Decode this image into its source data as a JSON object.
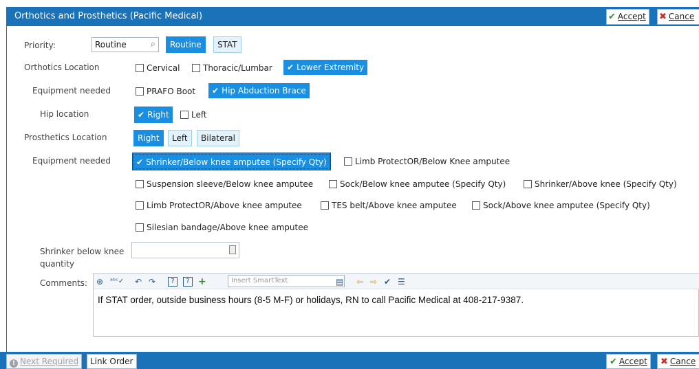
{
  "window": {
    "title": "Orthotics and Prosthetics (Pacific Medical)",
    "accept_label": "Accept",
    "cancel_label": "Cance"
  },
  "priority": {
    "label": "Priority:",
    "value": "Routine",
    "buttons": [
      "Routine",
      "STAT"
    ],
    "selected": "Routine"
  },
  "orthotics_location": {
    "label": "Orthotics Location",
    "options": [
      {
        "label": "Cervical",
        "checked": false
      },
      {
        "label": "Thoracic/Lumbar",
        "checked": false
      },
      {
        "label": "Lower Extremity",
        "checked": true
      }
    ]
  },
  "orthotics_equipment": {
    "label": "Equipment needed",
    "options": [
      {
        "label": "PRAFO Boot",
        "checked": false
      },
      {
        "label": "Hip Abduction Brace",
        "checked": true
      }
    ]
  },
  "hip_location": {
    "label": "Hip location",
    "options": [
      {
        "label": "Right",
        "checked": true
      },
      {
        "label": "Left",
        "checked": false
      }
    ]
  },
  "prosthetics_location": {
    "label": "Prosthetics Location",
    "buttons": [
      "Right",
      "Left",
      "Bilateral"
    ],
    "selected": "Right"
  },
  "prosthetics_equipment": {
    "label": "Equipment needed",
    "options": [
      {
        "label": "Shrinker/Below knee amputee (Specify Qty)",
        "checked": true
      },
      {
        "label": "Limb ProtectOR/Below Knee amputee",
        "checked": false
      },
      {
        "label": "Suspension sleeve/Below knee amputee",
        "checked": false
      },
      {
        "label": "Sock/Below knee amputee (Specify Qty)",
        "checked": false
      },
      {
        "label": "Shrinker/Above knee (Specify Qty)",
        "checked": false
      },
      {
        "label": "Limb ProtectOR/Above knee amputee",
        "checked": false
      },
      {
        "label": "TES belt/Above knee amputee",
        "checked": false
      },
      {
        "label": "Sock/Above knee amputee (Specify Qty)",
        "checked": false
      },
      {
        "label": "Silesian bandage/Above knee amputee",
        "checked": false
      }
    ]
  },
  "shrinker_qty": {
    "label_line1": "Shrinker below knee",
    "label_line2": "quantity",
    "value": ""
  },
  "comments": {
    "label": "Comments:",
    "smarttext_placeholder": "Insert SmartText",
    "text": "If STAT order, outside business hours (8-5 M-F) or holidays, RN to call Pacific Medical at 408-217-9387."
  },
  "footer": {
    "next_required": "Next Required",
    "link_order": "Link Order",
    "accept_label": "Accept",
    "cancel_label": "Cance"
  },
  "colors": {
    "header_blue": "#1a72b8",
    "selected_blue": "#1a8ee0"
  }
}
